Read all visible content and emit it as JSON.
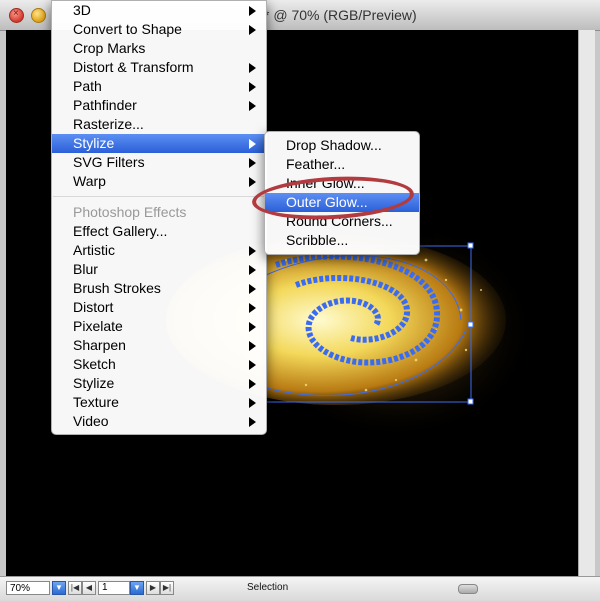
{
  "window": {
    "title": "* @ 70% (RGB/Preview)"
  },
  "main_menu": {
    "items": [
      {
        "label": "3D",
        "submenu": true
      },
      {
        "label": "Convert to Shape",
        "submenu": true
      },
      {
        "label": "Crop Marks",
        "submenu": false
      },
      {
        "label": "Distort & Transform",
        "submenu": true
      },
      {
        "label": "Path",
        "submenu": true
      },
      {
        "label": "Pathfinder",
        "submenu": true
      },
      {
        "label": "Rasterize...",
        "submenu": false
      },
      {
        "label": "Stylize",
        "submenu": true,
        "highlighted": true
      },
      {
        "label": "SVG Filters",
        "submenu": true
      },
      {
        "label": "Warp",
        "submenu": true
      }
    ],
    "section_header": "Photoshop Effects",
    "ps_items": [
      {
        "label": "Effect Gallery...",
        "submenu": false
      },
      {
        "label": "Artistic",
        "submenu": true
      },
      {
        "label": "Blur",
        "submenu": true
      },
      {
        "label": "Brush Strokes",
        "submenu": true
      },
      {
        "label": "Distort",
        "submenu": true
      },
      {
        "label": "Pixelate",
        "submenu": true
      },
      {
        "label": "Sharpen",
        "submenu": true
      },
      {
        "label": "Sketch",
        "submenu": true
      },
      {
        "label": "Stylize",
        "submenu": true
      },
      {
        "label": "Texture",
        "submenu": true
      },
      {
        "label": "Video",
        "submenu": true
      }
    ]
  },
  "stylize_submenu": {
    "items": [
      {
        "label": "Drop Shadow..."
      },
      {
        "label": "Feather..."
      },
      {
        "label": "Inner Glow..."
      },
      {
        "label": "Outer Glow...",
        "highlighted": true
      },
      {
        "label": "Round Corners..."
      },
      {
        "label": "Scribble..."
      }
    ]
  },
  "statusbar": {
    "zoom": "70%",
    "page": "1",
    "status_text": "Selection"
  },
  "colors": {
    "highlight": "#3a6ee0",
    "annotation": "#b23b40",
    "path_stroke": "#3b6cf0",
    "galaxy_core": "#f6e27a"
  },
  "icons": [
    "close-icon",
    "minimize-icon",
    "submenu-arrow-icon",
    "dropdown-arrow-icon",
    "first-page-icon",
    "prev-page-icon",
    "next-page-icon",
    "last-page-icon"
  ]
}
